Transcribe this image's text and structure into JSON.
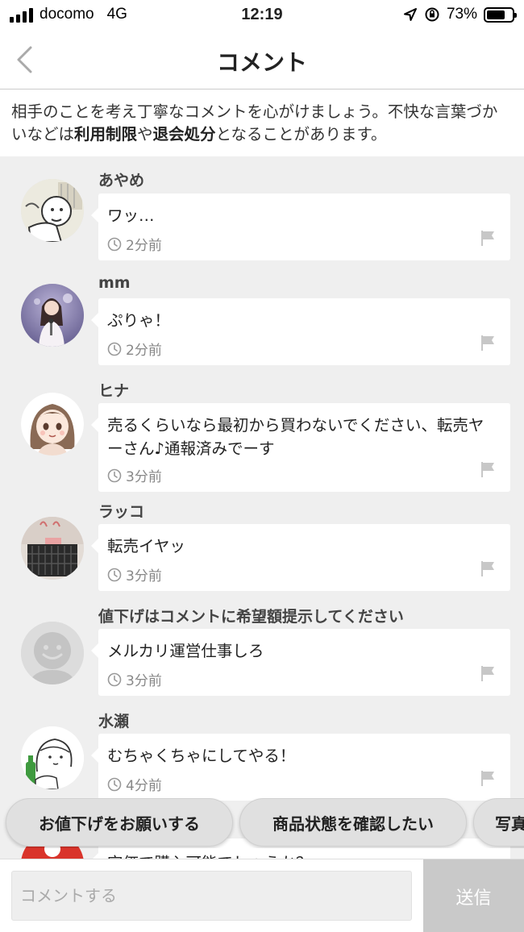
{
  "status_bar": {
    "carrier": "docomo",
    "network": "4G",
    "time": "12:19",
    "battery_percent": "73%",
    "battery_level": 0.73
  },
  "header": {
    "title": "コメント"
  },
  "notice": {
    "part1": "相手のことを考え丁寧なコメントを心がけましょう。不快な言葉づかいなどは",
    "bold1": "利用制限",
    "part2": "や",
    "bold2": "退会処分",
    "part3": "となることがあります。"
  },
  "comments": [
    {
      "name": "あやめ",
      "text": "ワッ…",
      "time": "2分前"
    },
    {
      "name": "mm",
      "text": "ぷりゃ！",
      "time": "2分前"
    },
    {
      "name": "ヒナ",
      "text": "売るくらいなら最初から買わないでください、転売ヤーさん♪通報済みでーす",
      "time": "3分前"
    },
    {
      "name": "ラッコ",
      "text": "転売イヤッ",
      "time": "3分前"
    },
    {
      "name": "値下げはコメントに希望額提示してください",
      "text": "メルカリ運営仕事しろ",
      "time": "3分前"
    },
    {
      "name": "水瀬",
      "text": "むちゃくちゃにしてやる！",
      "time": "4分前"
    },
    {
      "name": "",
      "text": "定価で購入可能でしょうか？",
      "time": ""
    }
  ],
  "quick_replies": [
    "お値下げをお願いする",
    "商品状態を確認したい",
    "写真を追加してほしい"
  ],
  "input": {
    "placeholder": "コメントする",
    "value": ""
  },
  "send_label": "送信",
  "colors": {
    "background_gray": "#efefef",
    "send_disabled": "#c9c9c9",
    "chip_bg": "#e0e0e0",
    "avatar_red": "#d9342b"
  },
  "icons": [
    "back-chevron-icon",
    "clock-icon",
    "flag-icon",
    "location-arrow-icon",
    "rotation-lock-icon",
    "battery-icon",
    "signal-icon"
  ]
}
